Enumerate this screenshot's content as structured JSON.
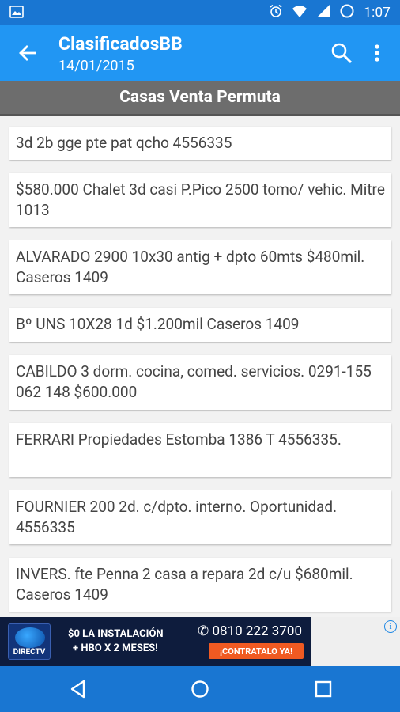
{
  "status_bar": {
    "time": "1:07",
    "icons": [
      "image-icon",
      "alarm-icon",
      "wifi-icon",
      "signal-icon",
      "battery-icon"
    ]
  },
  "app_bar": {
    "title": "ClasificadosBB",
    "subtitle": "14/01/2015",
    "actions": [
      "search-icon",
      "more-vert-icon"
    ]
  },
  "section": {
    "title": "Casas Venta Permuta"
  },
  "listings": [
    {
      "text": "3d 2b gge pte pat qcho 4556335"
    },
    {
      "text": "$580.000 Chalet 3d casi P.Pico 2500 tomo/ vehic. Mitre 1013"
    },
    {
      "text": "ALVARADO 2900 10x30 antig + dpto 60mts $480mil. Caseros 1409"
    },
    {
      "text": "Bº UNS 10X28 1d $1.200mil Caseros 1409"
    },
    {
      "text": "CABILDO 3 dorm. cocina, comed. servicios. 0291-155 062 148 $600.000"
    },
    {
      "text": "FERRARI Propiedades Estomba 1386 T 4556335."
    },
    {
      "text": "FOURNIER 200 2d. c/dpto. interno. Oportunidad. 4556335"
    },
    {
      "text": "INVERS. fte Penna 2 casa a repara 2d c/u $680mil. Caseros 1409"
    }
  ],
  "ad": {
    "brand": "DIRECTV",
    "line1": "$0 LA INSTALACIÓN",
    "line2": "+ HBO X 2 MESES!",
    "phone": "0810 222 3700",
    "cta": "¡CONTRATALO YA!",
    "info": "i"
  },
  "colors": {
    "status_bar": "#1976d2",
    "app_bar": "#2196f3",
    "section_header": "#6d6d6d",
    "background": "#f2f2f2"
  }
}
